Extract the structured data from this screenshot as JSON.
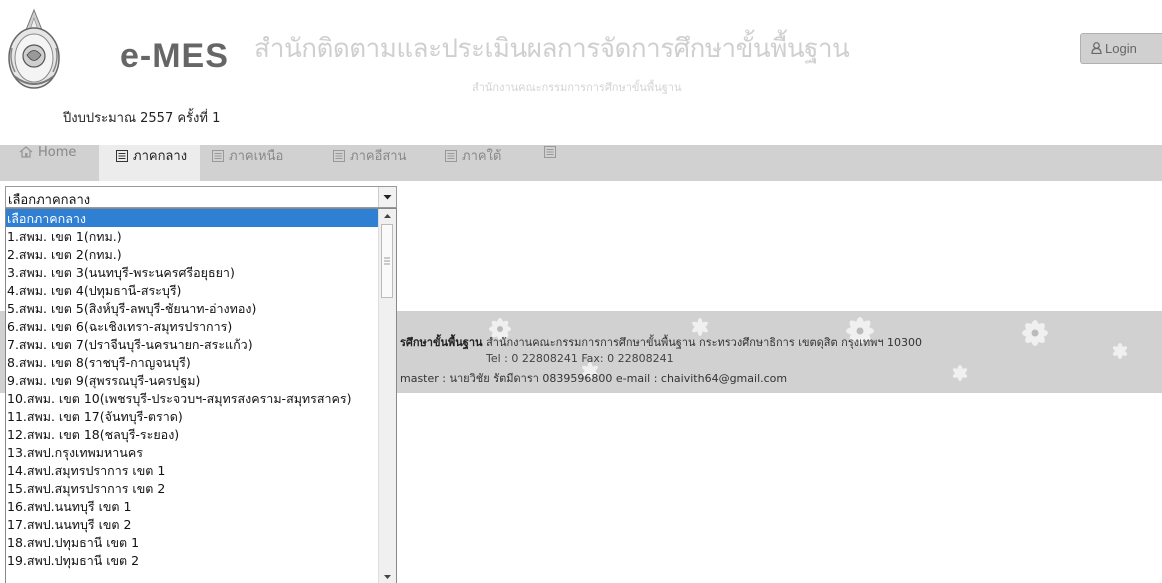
{
  "header": {
    "brand": "e-MES",
    "org_name": "สำนักติดตามและประเมินผลการจัดการศึกษาขั้นพื้นฐาน",
    "org_parent": "สำนักงานคณะกรรมการการศึกษาขั้นพื้นฐาน",
    "budget_round": "ปีงบประมาณ 2557 ครั้งที่ 1",
    "login_label": "Login"
  },
  "nav": {
    "tabs": [
      {
        "label": "Home",
        "icon": "home-icon"
      },
      {
        "label": "ภาคกลาง",
        "icon": "list-icon"
      },
      {
        "label": "ภาคเหนือ",
        "icon": "list-icon"
      },
      {
        "label": "ภาคอีสาน",
        "icon": "list-icon"
      },
      {
        "label": "ภาคใต้",
        "icon": "list-icon"
      },
      {
        "label": "",
        "icon": "list-icon"
      }
    ],
    "active_tab": "ภาคกลาง"
  },
  "region_select": {
    "selected": "เลือกภาคกลาง",
    "options": [
      "เลือกภาคกลาง",
      "1.สพม. เขต 1(กทม.)",
      "2.สพม. เขต 2(กทม.)",
      "3.สพม. เขต 3(นนทบุรี-พระนครศรีอยุธยา)",
      "4.สพม. เขต 4(ปทุมธานี-สระบุรี)",
      "5.สพม. เขต 5(สิงห์บุรี-ลพบุรี-ชัยนาท-อ่างทอง)",
      "6.สพม. เขต 6(ฉะเชิงเทรา-สมุทรปราการ)",
      "7.สพม. เขต 7(ปราจีนบุรี-นครนายก-สระแก้ว)",
      "8.สพม. เขต 8(ราชบุรี-กาญจนบุรี)",
      "9.สพม. เขต 9(สุพรรณบุรี-นครปฐม)",
      "10.สพม. เขต 10(เพชรบุรี-ประจวบฯ-สมุทรสงคราม-สมุทรสาคร)",
      "11.สพม. เขต 17(จันทบุรี-ตราด)",
      "12.สพม. เขต 18(ชลบุรี-ระยอง)",
      "13.สพป.กรุงเทพมหานคร",
      "14.สพป.สมุทรปราการ เขต 1",
      "15.สพป.สมุทรปราการ เขต 2",
      "16.สพป.นนทบุรี เขต 1",
      "17.สพป.นนทบุรี เขต 2",
      "18.สพป.ปทุมธานี เขต 1",
      "19.สพป.ปทุมธานี เขต 2"
    ]
  },
  "footer": {
    "org_bold": "รศึกษาขั้นพื้นฐาน",
    "address": "สำนักงานคณะกรรมการการศึกษาขั้นพื้นฐาน กระทรวงศึกษาธิการ เขตดุสิต กรุงเทพฯ 10300",
    "phone": "Tel : 0 22808241 Fax: 0 22808241",
    "webmaster": "master : นายวิชัย รัตมีดารา 0839596800 e-mail : chaivith64@gmail.com"
  }
}
